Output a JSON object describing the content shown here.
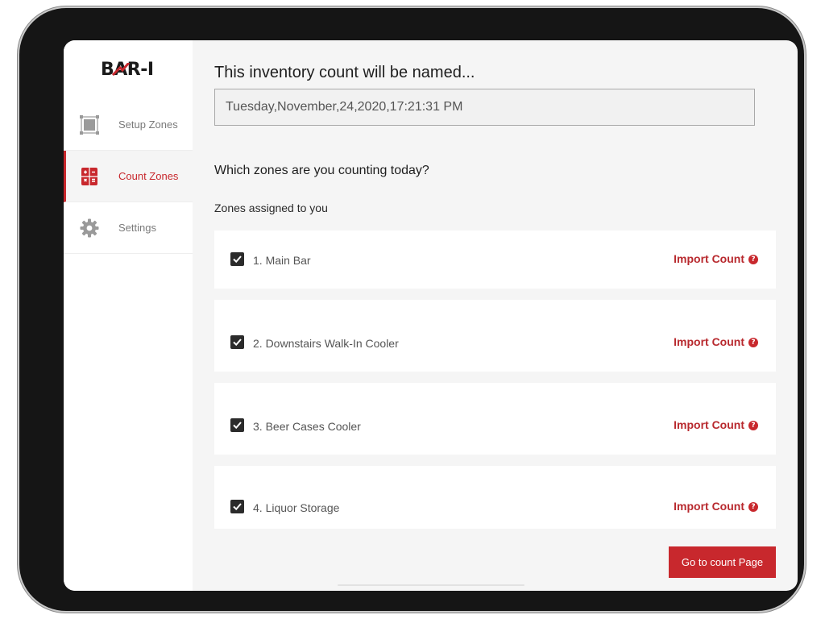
{
  "app": {
    "logo_text": "BAR-I",
    "brand_color": "#c8282d"
  },
  "sidebar": {
    "items": [
      {
        "label": "Setup Zones",
        "icon": "setup-zones-icon",
        "active": false
      },
      {
        "label": "Count Zones",
        "icon": "calculator-icon",
        "active": true
      },
      {
        "label": "Settings",
        "icon": "gear-icon",
        "active": false
      }
    ]
  },
  "main": {
    "title": "This inventory count will be named...",
    "count_name_value": "Tuesday,November,24,2020,17:21:31 PM",
    "question": "Which zones are you counting today?",
    "assigned_label": "Zones assigned to you",
    "zones": [
      {
        "name": "1. Main Bar",
        "checked": true,
        "import_label": "Import Count",
        "help_icon": "help-icon"
      },
      {
        "name": "2. Downstairs Walk-In Cooler",
        "checked": true,
        "import_label": "Import Count",
        "help_icon": "help-icon"
      },
      {
        "name": "3. Beer Cases Cooler",
        "checked": true,
        "import_label": "Import Count",
        "help_icon": "help-icon"
      },
      {
        "name": "4. Liquor Storage",
        "checked": true,
        "import_label": "Import Count",
        "help_icon": "help-icon"
      }
    ],
    "go_button_label": "Go to count Page"
  }
}
